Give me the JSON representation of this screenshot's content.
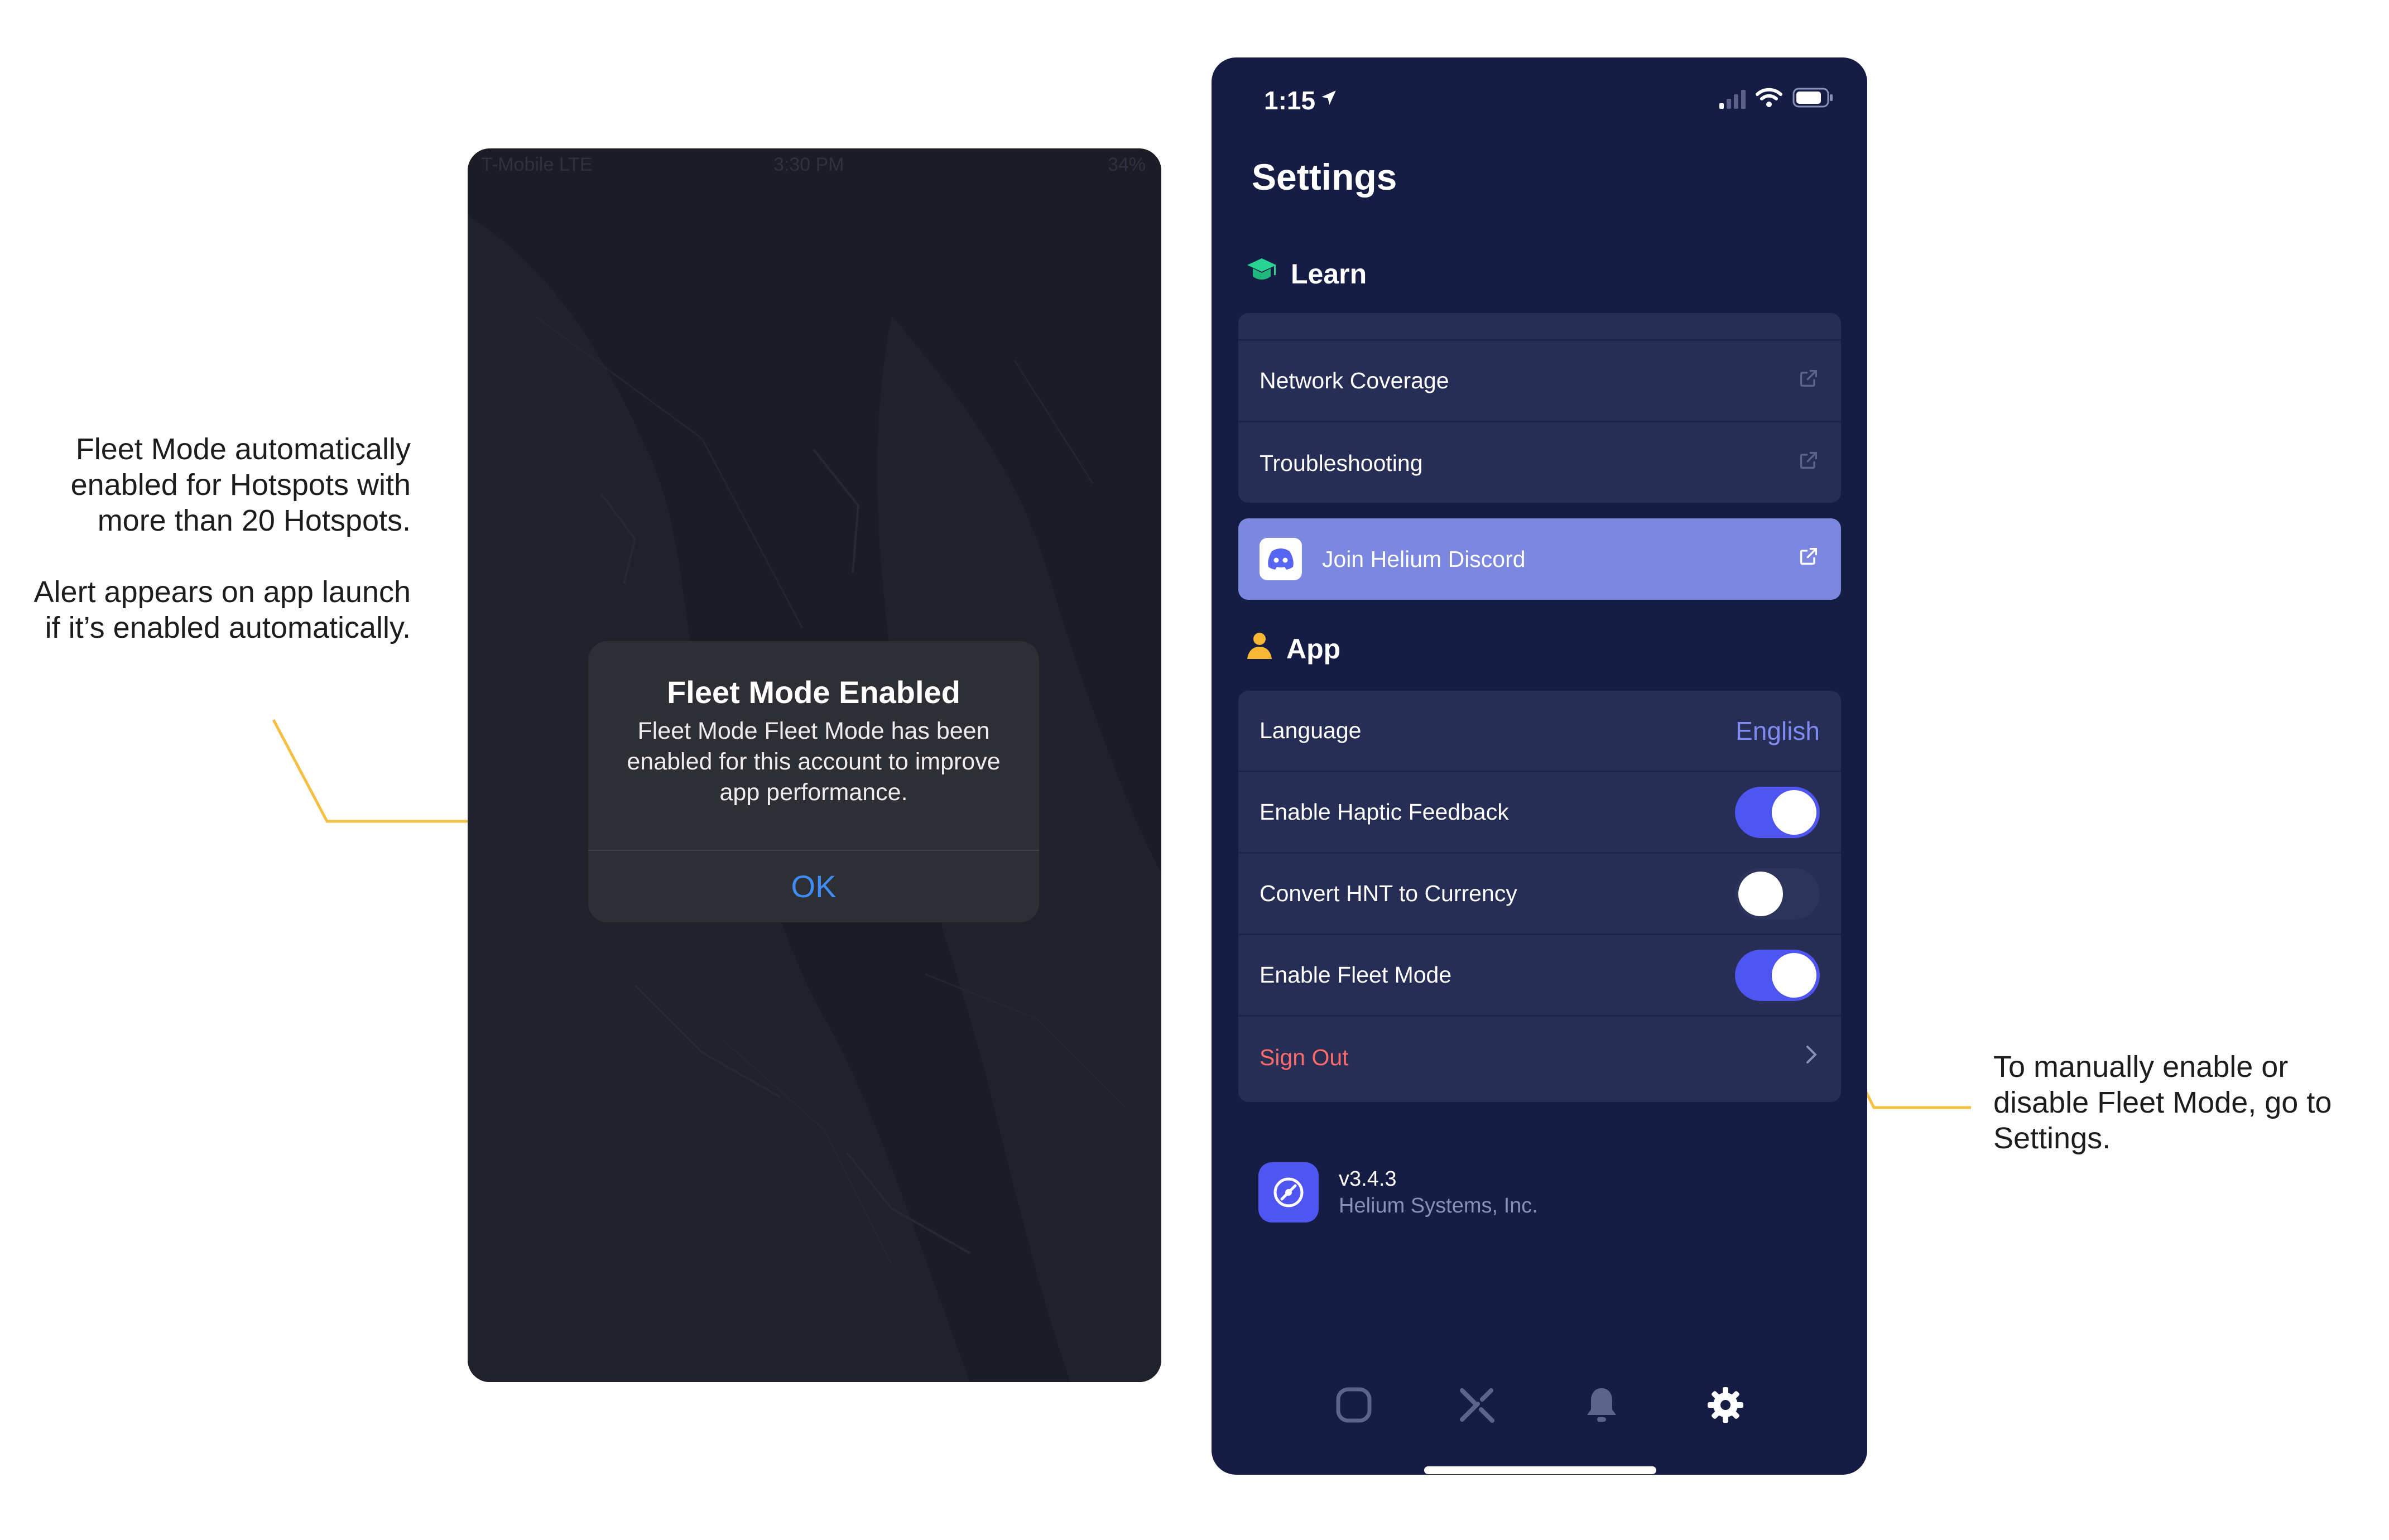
{
  "annotations": {
    "left_p1": "Fleet Mode automatically enabled for Hotspots with more than 20 Hotspots.",
    "left_p2": "Alert appears on app launch if it’s enabled automatically.",
    "right": "To manually enable or disable Fleet Mode, go to Settings.",
    "connector_color": "#f5c042"
  },
  "left_phone": {
    "status_bar": {
      "carrier": "T-Mobile  LTE",
      "time": "3:30 PM",
      "battery": "34%"
    },
    "alert": {
      "title": "Fleet Mode Enabled",
      "message": "Fleet Mode Fleet Mode has been enabled for this account to improve app performance.",
      "ok_label": "OK"
    }
  },
  "settings_phone": {
    "status_bar": {
      "time": "1:15"
    },
    "title": "Settings",
    "learn": {
      "heading": "Learn",
      "items": [
        {
          "label": "Network Coverage",
          "icon": "external-link-icon"
        },
        {
          "label": "Troubleshooting",
          "icon": "external-link-icon"
        }
      ],
      "discord": {
        "label": "Join Helium Discord",
        "icon": "discord-icon"
      }
    },
    "app": {
      "heading": "App",
      "language": {
        "label": "Language",
        "value": "English"
      },
      "haptic": {
        "label": "Enable Haptic Feedback",
        "on": true
      },
      "convert": {
        "label": "Convert HNT to Currency",
        "on": false
      },
      "fleet": {
        "label": "Enable Fleet Mode",
        "on": true
      },
      "signout": {
        "label": "Sign Out"
      }
    },
    "about": {
      "version": "v3.4.3",
      "company": "Helium Systems, Inc."
    },
    "tabs": [
      "hotspots-icon",
      "activity-icon",
      "bell-icon",
      "gear-icon"
    ],
    "colors": {
      "background": "#151d45",
      "card": "#272e55",
      "accent": "#4f55f0",
      "discord": "#7c88e0",
      "danger": "#ff6b6b"
    }
  }
}
